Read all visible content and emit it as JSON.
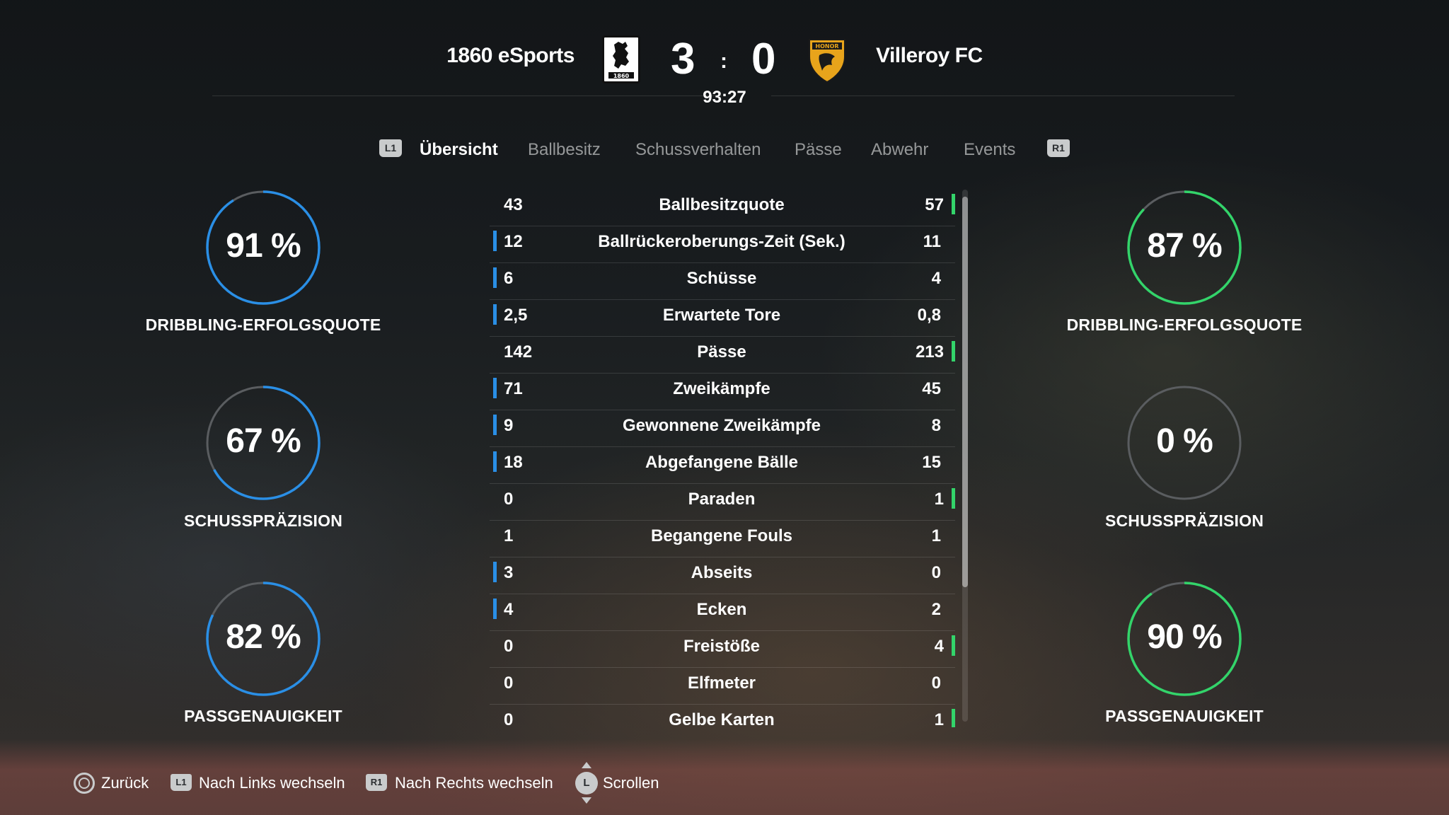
{
  "header": {
    "home_team": "1860 eSports",
    "away_team": "Villeroy FC",
    "home_score": "3",
    "away_score": "0",
    "separator": ":",
    "clock": "93:27",
    "home_crest_text": "1860",
    "away_crest_text": "HONOR"
  },
  "tabs": {
    "left_button": "L1",
    "right_button": "R1",
    "items": [
      {
        "label": "Übersicht",
        "active": true
      },
      {
        "label": "Ballbesitz",
        "active": false
      },
      {
        "label": "Schussverhalten",
        "active": false
      },
      {
        "label": "Pässe",
        "active": false
      },
      {
        "label": "Abwehr",
        "active": false
      },
      {
        "label": "Events",
        "active": false
      }
    ]
  },
  "home_rings": [
    {
      "value": "91 %",
      "label": "DRIBBLING-ERFOLGSQUOTE",
      "percent": 91
    },
    {
      "value": "67 %",
      "label": "SCHUSSPRÄZISION",
      "percent": 67
    },
    {
      "value": "82 %",
      "label": "PASSGENAUIGKEIT",
      "percent": 82
    }
  ],
  "away_rings": [
    {
      "value": "87 %",
      "label": "DRIBBLING-ERFOLGSQUOTE",
      "percent": 87
    },
    {
      "value": "0 %",
      "label": "SCHUSSPRÄZISION",
      "percent": 0
    },
    {
      "value": "90 %",
      "label": "PASSGENAUIGKEIT",
      "percent": 90
    }
  ],
  "stats": [
    {
      "name": "Ballbesitzquote",
      "home": "43",
      "away": "57",
      "leader": "away"
    },
    {
      "name": "Ballrückeroberungs-Zeit (Sek.)",
      "home": "12",
      "away": "11",
      "leader": "home"
    },
    {
      "name": "Schüsse",
      "home": "6",
      "away": "4",
      "leader": "home"
    },
    {
      "name": "Erwartete Tore",
      "home": "2,5",
      "away": "0,8",
      "leader": "home"
    },
    {
      "name": "Pässe",
      "home": "142",
      "away": "213",
      "leader": "away"
    },
    {
      "name": "Zweikämpfe",
      "home": "71",
      "away": "45",
      "leader": "home"
    },
    {
      "name": "Gewonnene Zweikämpfe",
      "home": "9",
      "away": "8",
      "leader": "home"
    },
    {
      "name": "Abgefangene Bälle",
      "home": "18",
      "away": "15",
      "leader": "home"
    },
    {
      "name": "Paraden",
      "home": "0",
      "away": "1",
      "leader": "away"
    },
    {
      "name": "Begangene Fouls",
      "home": "1",
      "away": "1",
      "leader": "none"
    },
    {
      "name": "Abseits",
      "home": "3",
      "away": "0",
      "leader": "home"
    },
    {
      "name": "Ecken",
      "home": "4",
      "away": "2",
      "leader": "home"
    },
    {
      "name": "Freistöße",
      "home": "0",
      "away": "4",
      "leader": "away"
    },
    {
      "name": "Elfmeter",
      "home": "0",
      "away": "0",
      "leader": "none"
    },
    {
      "name": "Gelbe Karten",
      "home": "0",
      "away": "1",
      "leader": "away"
    }
  ],
  "footer": {
    "back_label": "Zurück",
    "left_switch_button": "L1",
    "left_switch_label": "Nach Links wechseln",
    "right_switch_button": "R1",
    "right_switch_label": "Nach Rechts wechseln",
    "scroll_button": "L",
    "scroll_label": "Scrollen"
  },
  "colors": {
    "home_accent": "#2a8fe6",
    "away_accent": "#33d46a",
    "ring_track": "#5a5d60"
  },
  "icons": {
    "home_crest": "lion-crest-icon",
    "away_crest": "eagle-shield-icon",
    "back": "circle-button-icon",
    "scroll": "left-stick-icon"
  }
}
